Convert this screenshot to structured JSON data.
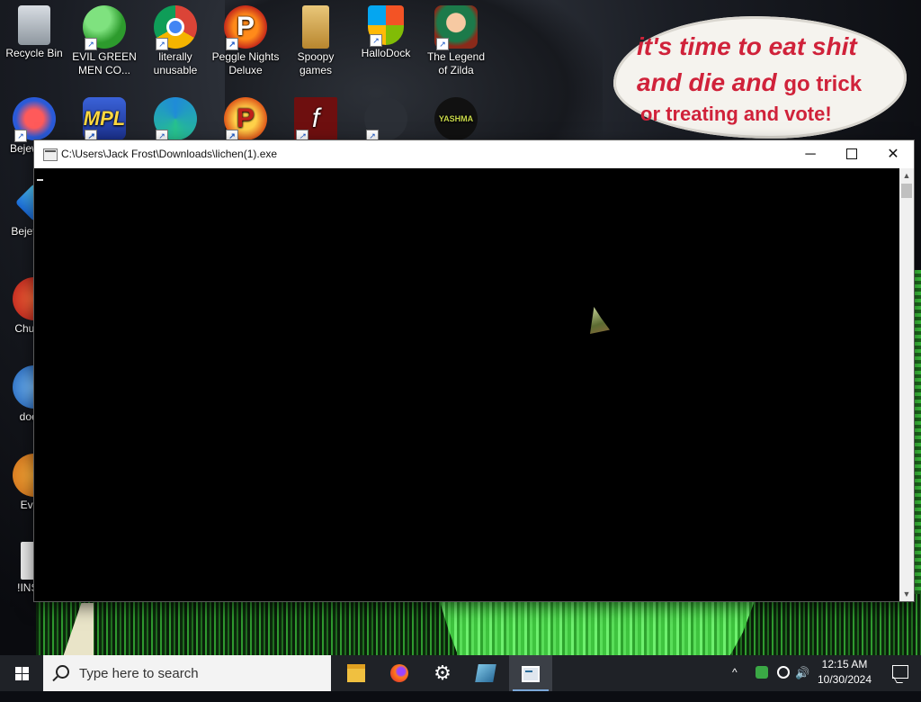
{
  "wallpaper": {
    "bubble_line1": "it's time to eat shit",
    "bubble_line2a": "and die and",
    "bubble_line2b": "go trick",
    "bubble_line3": "or treating and vote!"
  },
  "desktop_icons": [
    {
      "label": "Recycle Bin",
      "icon": "recycle-bin-icon"
    },
    {
      "label": "EVIL GREEN MEN CO...",
      "icon": "messenger-icon"
    },
    {
      "label": "literally unusable",
      "icon": "chrome-icon"
    },
    {
      "label": "Peggle Nights Deluxe",
      "icon": "peggle-icon"
    },
    {
      "label": "Spoopy games",
      "icon": "folder-icon"
    },
    {
      "label": "HalloDock",
      "icon": "windows-shield-icon"
    },
    {
      "label": "The Legend of Zilda",
      "icon": "zelda-icon"
    },
    {
      "label": "Bejew Del",
      "icon": "bejeweled-icon"
    },
    {
      "label": "",
      "icon": "mpl-icon"
    },
    {
      "label": "",
      "icon": "edge-icon"
    },
    {
      "label": "",
      "icon": "peggle-icon"
    },
    {
      "label": "",
      "icon": "flash-icon"
    },
    {
      "label": "",
      "icon": "app-icon"
    },
    {
      "label": "YASHMA",
      "icon": "yashma-icon"
    },
    {
      "label": "Bejev Del",
      "icon": "bejeweled-icon"
    },
    {
      "label": "Chu Del",
      "icon": "chuzzle-icon"
    },
    {
      "label": "doesn",
      "icon": "app-icon"
    },
    {
      "label": "Every",
      "icon": "app-icon"
    },
    {
      "label": "!INSTA",
      "icon": "installer-icon"
    }
  ],
  "window": {
    "title": "C:\\Users\\Jack Frost\\Downloads\\lichen(1).exe",
    "minimize": "─",
    "close": "✕"
  },
  "taskbar": {
    "search_placeholder": "Type here to search",
    "apps": [
      "file-explorer",
      "firefox",
      "settings",
      "app",
      "console"
    ],
    "tray_chevron": "^",
    "volume": "🔊",
    "time": "12:15 AM",
    "date": "10/30/2024"
  },
  "colors": {
    "taskbar_bg": "#1f2227",
    "bubble_text": "#d0223a",
    "console_bg": "#000000"
  }
}
